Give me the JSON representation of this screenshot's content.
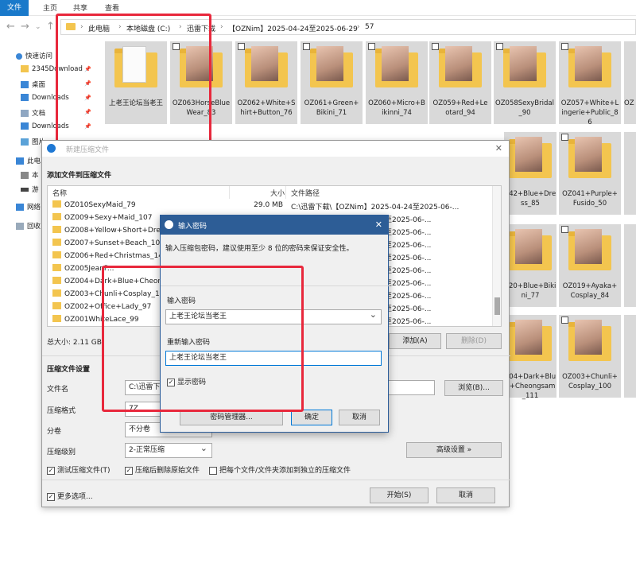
{
  "ribbon": {
    "tabs": [
      "文件",
      "主页",
      "共享",
      "查看"
    ]
  },
  "address": {
    "crumbs": [
      "此电脑",
      "本地磁盘 (C:)",
      "迅雷下载",
      "【OZNim】2025-04-24至2025-06-29",
      "57"
    ]
  },
  "sidebar": {
    "items": [
      "快速访问",
      "2345Download",
      "桌面",
      "Downloads",
      "文档",
      "Downloads",
      "图片",
      "此电",
      "本",
      "游",
      "网络",
      "回收"
    ]
  },
  "tiles_row1": [
    "上老王论坛当老王",
    "OZ063HorseBlueWear_83",
    "OZ062+White+Shirt+Button_76",
    "OZ061+Green+Bikini_71",
    "OZ060+Micro+Bikinni_74",
    "OZ059+Red+Leotard_94",
    "OZ058SexyBridal_90",
    "OZ057+White+Lingerie+Public_86",
    "OZ"
  ],
  "tiles_right": [
    "042+Blue+Dress_85",
    "OZ041+Purple+Fusido_50",
    "020+Blue+Bikini_77",
    "OZ019+Ayaka+Cosplay_84",
    "004+Dark+Blue+Cheongsam_111",
    "OZ003+Chunli+Cosplay_100"
  ],
  "archive_dialog": {
    "title": "新建压缩文件",
    "header": "添加文件到压缩文件",
    "columns": [
      "名称",
      "大小",
      "文件路径"
    ],
    "files": [
      {
        "name": "OZ010SexyMaid_79",
        "size": "29.0 MB",
        "path": "C:\\迅雷下载\\【OZNim】2025-04-24至2025-06-..."
      },
      {
        "name": "OZ009+Sexy+Maid_107",
        "size": "",
        "path": "...-04-24至2025-06-..."
      },
      {
        "name": "OZ008+Yellow+Short+Dress",
        "size": "",
        "path": "...-04-24至2025-06-..."
      },
      {
        "name": "OZ007+Sunset+Beach_104",
        "size": "",
        "path": "...-04-24至2025-06-..."
      },
      {
        "name": "OZ006+Red+Christmas_145",
        "size": "",
        "path": "...-04-24至2025-06-..."
      },
      {
        "name": "OZ005JeanP...",
        "size": "",
        "path": "...-04-24至2025-06-..."
      },
      {
        "name": "OZ004+Dark+Blue+Cheongs",
        "size": "",
        "path": "...-04-24至2025-06-..."
      },
      {
        "name": "OZ003+Chunli+Cosplay_100",
        "size": "",
        "path": "...-04-24至2025-06-..."
      },
      {
        "name": "OZ002+Office+Lady_97",
        "size": "",
        "path": "...-04-24至2025-06-..."
      },
      {
        "name": "OZ001WhiteLace_99",
        "size": "",
        "path": "...-04-24至2025-06-..."
      }
    ],
    "total_size": "总大小: 2.11 GB",
    "add_btn": "添加(A)",
    "delete_btn": "删除(D)",
    "settings_header": "压缩文件设置",
    "filename_label": "文件名",
    "filename_value": "C:\\迅雷下",
    "browse_btn": "浏览(B)...",
    "format_label": "压缩格式",
    "format_value": "7Z",
    "split_label": "分卷",
    "split_value": "不分卷",
    "level_label": "压缩级别",
    "level_value": "2-正常压缩",
    "advanced_btn": "高级设置 »",
    "opt_test": "测试压缩文件(T)",
    "opt_delete": "压缩后删除原始文件",
    "opt_separate": "把每个文件/文件夹添加到独立的压缩文件",
    "more_options": "更多选项...",
    "start_btn": "开始(S)",
    "cancel_btn": "取消"
  },
  "password_dialog": {
    "title": "输入密码",
    "hint": "输入压缩包密码，建议使用至少 8 位的密码来保证安全性。",
    "enter_label": "输入密码",
    "enter_value": "上老王论坛当老王",
    "reenter_label": "重新输入密码",
    "reenter_value": "上老王论坛当老王",
    "show_pwd": "显示密码",
    "manager_btn": "密码管理器...",
    "ok_btn": "确定",
    "cancel_btn": "取消"
  },
  "colors": {
    "accent": "#1979ca",
    "highlight": "#e8283c",
    "dialog_title": "#2d5d96"
  }
}
